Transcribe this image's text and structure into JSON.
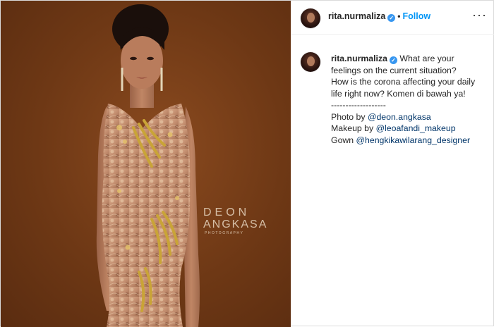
{
  "post": {
    "username": "rita.nurmaliza",
    "verified_badge_icon": "verified-check-icon",
    "separator": "•",
    "follow_label": "Follow",
    "more_label": "···"
  },
  "photo": {
    "watermark": {
      "line1": "DEON",
      "line2": "ANGKASA",
      "line3": "PHOTOGRAPHY"
    },
    "colors": {
      "background": "#6e3815",
      "gown_base": "#c9987a",
      "gold_embroidery": "#c9a437"
    }
  },
  "caption": {
    "username": "rita.nurmaliza",
    "line1": "What are your",
    "line2": "feelings on the current situation?",
    "line3": "How is the corona affecting your daily",
    "line4": "life right now? Komen di bawah ya!",
    "divider": "-------------------",
    "photo_prefix": "Photo by ",
    "photo_link": "@deon.angkasa",
    "makeup_prefix": "Makeup by ",
    "makeup_link": "@leoafandi_makeup",
    "gown_prefix": "Gown ",
    "gown_link": "@hengkikawilarang_designer"
  },
  "colors": {
    "link": "#003569",
    "follow": "#0095f6",
    "verified": "#3897f0",
    "text": "#262626"
  }
}
